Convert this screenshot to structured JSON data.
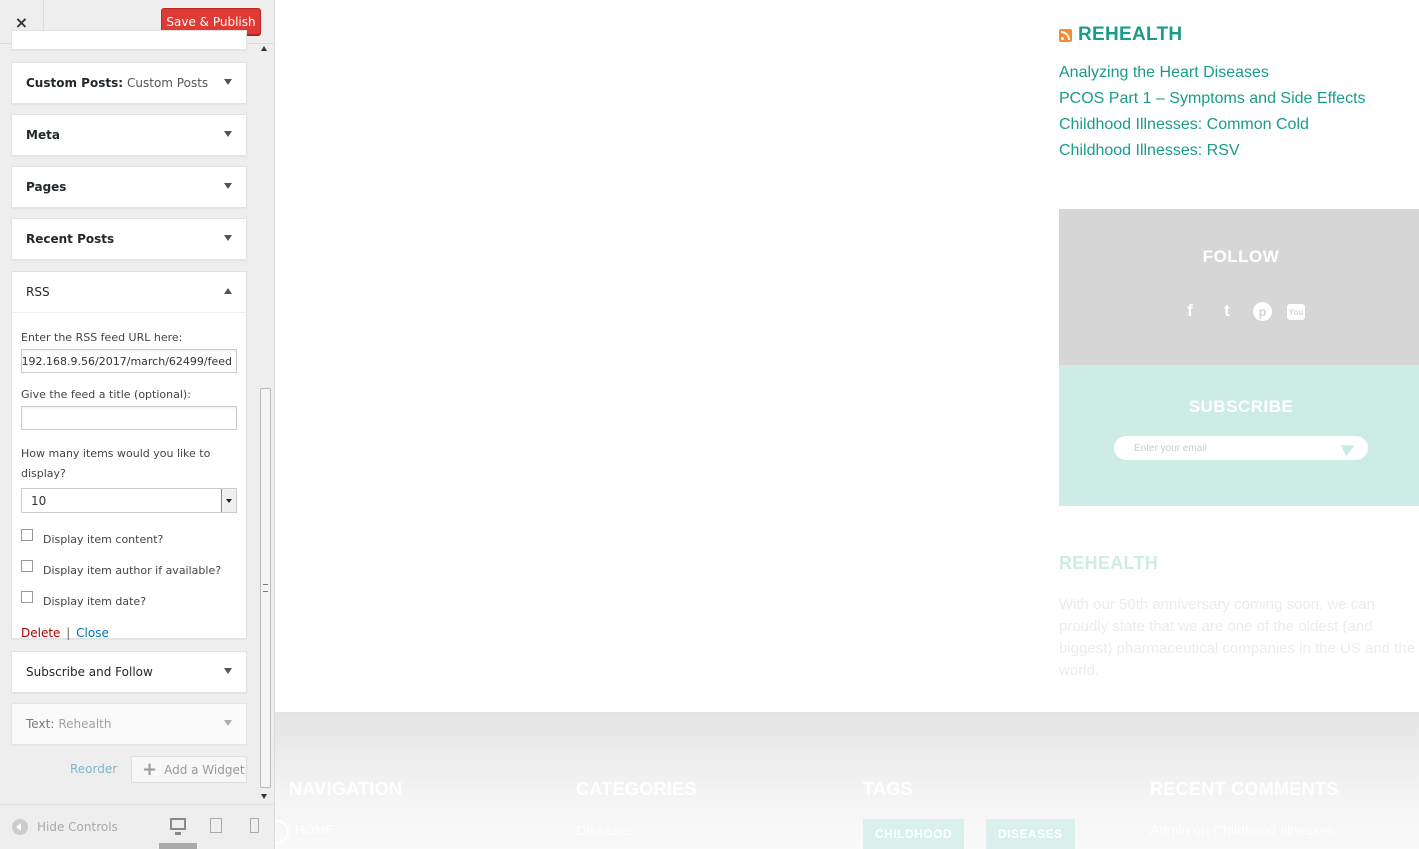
{
  "toolbar": {
    "close_label": "×",
    "save_label": "Save & Publish"
  },
  "widgets": {
    "custom_posts": {
      "title": "Custom Posts:",
      "subtitle": "Custom Posts"
    },
    "meta": {
      "title": "Meta"
    },
    "pages": {
      "title": "Pages"
    },
    "recent_posts": {
      "title": "Recent Posts"
    },
    "rss": {
      "title": "RSS",
      "url_label": "Enter the RSS feed URL here:",
      "url_value": "192.168.9.56/2017/march/62499/feed",
      "title_label": "Give the feed a title (optional):",
      "title_value": "",
      "items_label": "How many items would you like to display?",
      "items_value": "10",
      "opt_content": "Display item content?",
      "opt_author": "Display item author if available?",
      "opt_date": "Display item date?",
      "delete_label": "Delete",
      "separator": "|",
      "close_label": "Close"
    },
    "subscribe_follow": {
      "title": "Subscribe and Follow"
    },
    "text": {
      "title": "Text:",
      "subtitle": "Rehealth"
    }
  },
  "actions": {
    "reorder_label": "Reorder",
    "add_widget_label": "Add a Widget"
  },
  "footer_controls": {
    "hide_label": "Hide Controls"
  },
  "preview": {
    "rss_title": "REHEALTH",
    "rss_items": [
      "Analyzing the Heart Diseases",
      "PCOS Part 1 – Symptoms and Side Effects",
      "Childhood Illnesses: Common Cold",
      "Childhood Illnesses: RSV"
    ],
    "follow_title": "FOLLOW",
    "social": {
      "facebook": "f",
      "twitter": "t",
      "pinterest": "p",
      "youtube": "You"
    },
    "subscribe_title": "SUBSCRIBE",
    "email_placeholder": "Enter your email",
    "rehealth_title": "REHEALTH",
    "rehealth_text": "With our 50th anniversary coming soon, we can proudly state that we are one of the oldest (and biggest) pharmaceutical companies in the US and the world.",
    "footer": {
      "navigation_title": "NAVIGATION",
      "nav_item": "HOME",
      "categories_title": "CATEGORIES",
      "category_item": "Diseases",
      "tags_title": "TAGS",
      "tag_1": "CHILDHOOD",
      "tag_2": "DISEASES",
      "comments_title": "RECENT COMMENTS",
      "comment_item": "Admin on Childhood Illnesses:"
    }
  },
  "colors": {
    "accent_red": "#dd3b34",
    "preview_teal": "#1a9c8a",
    "follow_bg": "#d6d6d6",
    "subscribe_bg": "#cdece6"
  }
}
